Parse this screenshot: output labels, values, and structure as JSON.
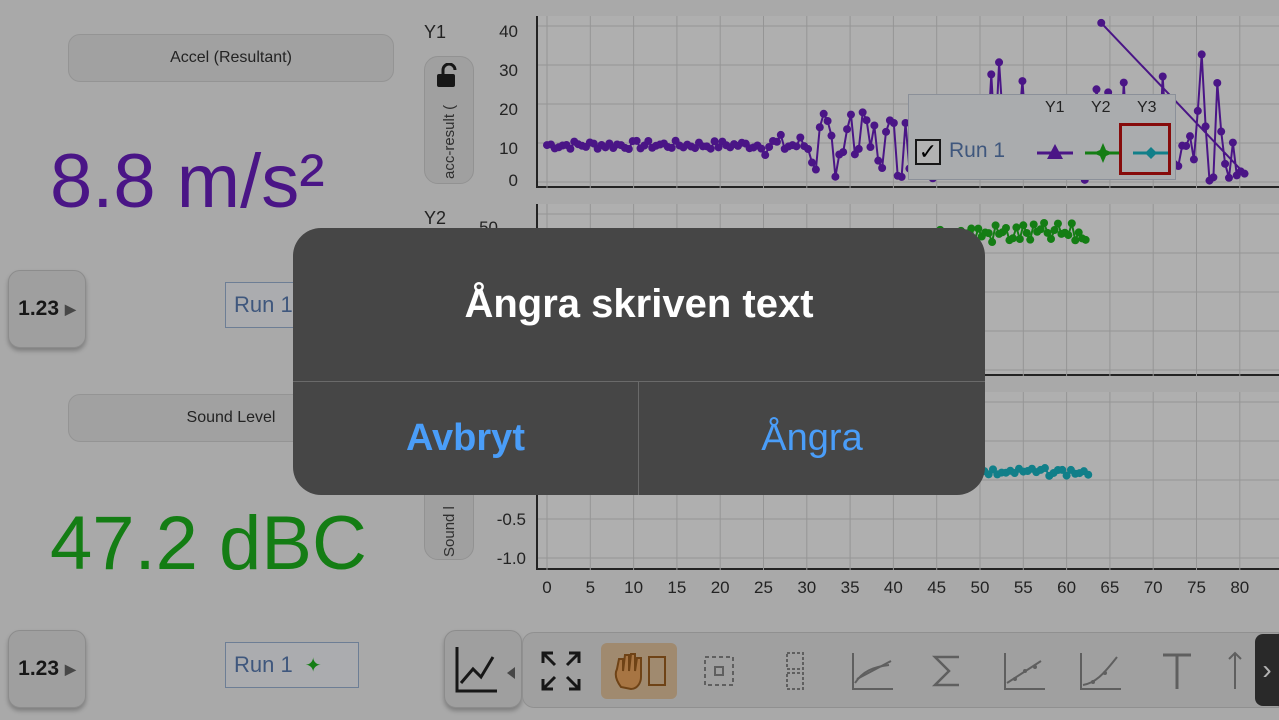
{
  "meters": [
    {
      "sensor": "Accel (Resultant)",
      "value": "8.8 m/s²",
      "color": "#6a1fc0",
      "mode": "1.23",
      "run": "Run 1"
    },
    {
      "sensor": "Sound Level",
      "value": "47.2 dBC",
      "color": "#1db31d",
      "mode": "1.23",
      "run": "Run 1"
    }
  ],
  "graphs": [
    {
      "tag": "Y1",
      "axis_label": "acc-result (",
      "yticks": [
        "40",
        "30",
        "20",
        "10",
        "0"
      ]
    },
    {
      "tag": "Y2",
      "axis_label": "",
      "yticks": [
        "50"
      ]
    },
    {
      "tag": "",
      "axis_label": "Sound l",
      "yticks": [
        "-0.5",
        "-1.0"
      ]
    }
  ],
  "xticks": [
    "0",
    "5",
    "10",
    "15",
    "20",
    "25",
    "30",
    "35",
    "40",
    "45",
    "50",
    "55",
    "60",
    "65",
    "70",
    "75",
    "80",
    "8"
  ],
  "legend": {
    "headers": [
      "Y1",
      "Y2",
      "Y3"
    ],
    "run": "Run 1",
    "checked": true,
    "colors": [
      "#6a1fc0",
      "#1db31d",
      "#19b6c4"
    ]
  },
  "chart_data": [
    {
      "type": "scatter",
      "series": [
        {
          "values_description_omitted": false,
          "x": [
            0,
            5,
            10,
            15,
            20,
            25,
            30,
            32,
            35,
            40,
            45,
            50,
            55,
            60,
            65,
            70,
            75,
            80
          ],
          "y": [
            10,
            11,
            10,
            10,
            10,
            10,
            14,
            25,
            20,
            12,
            18,
            22,
            28,
            16,
            24,
            15,
            20,
            10
          ]
        }
      ],
      "xlim": [
        0,
        82
      ],
      "ylim": [
        0,
        45
      ]
    },
    {
      "type": "scatter",
      "series": [
        {
          "x": [
            45,
            50,
            55,
            60,
            62
          ],
          "y": [
            48,
            47,
            50,
            46,
            47
          ]
        }
      ],
      "xlim": [
        0,
        82
      ]
    },
    {
      "type": "scatter",
      "series": [
        {
          "x": [
            45,
            50,
            55,
            60,
            62
          ],
          "y": [
            0.1,
            0.1,
            0.15,
            0.1,
            0.1
          ]
        }
      ],
      "xlim": [
        0,
        82
      ],
      "ylim": [
        -1.0,
        0.2
      ]
    }
  ],
  "tools": [
    "fullscreen",
    "pan",
    "region-select",
    "zoom-box",
    "tangent",
    "integral",
    "linear-fit",
    "curve-fit",
    "text",
    "more"
  ],
  "alert": {
    "title": "Ångra skriven text",
    "cancel": "Avbryt",
    "confirm": "Ångra"
  }
}
